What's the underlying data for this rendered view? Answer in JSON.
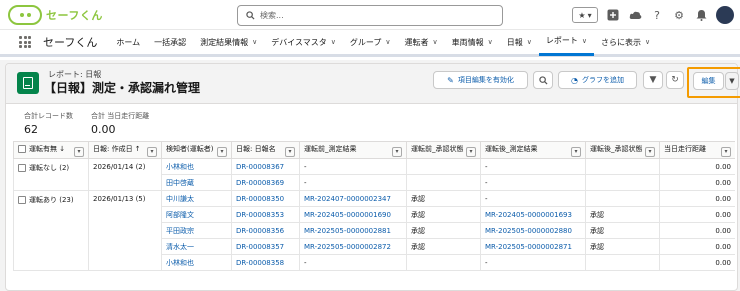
{
  "header": {
    "logo_text": "セーフくん",
    "search_placeholder": "検索..."
  },
  "nav": {
    "app_name": "セーフくん",
    "items": [
      {
        "label": "ホーム",
        "chevron": false
      },
      {
        "label": "一括承認",
        "chevron": false
      },
      {
        "label": "測定結果情報",
        "chevron": true
      },
      {
        "label": "デバイスマスタ",
        "chevron": true
      },
      {
        "label": "グループ",
        "chevron": true
      },
      {
        "label": "運転者",
        "chevron": true
      },
      {
        "label": "車両情報",
        "chevron": true
      },
      {
        "label": "日報",
        "chevron": true
      },
      {
        "label": "レポート",
        "chevron": true,
        "active": true
      },
      {
        "label": "さらに表示",
        "chevron": true
      }
    ]
  },
  "report": {
    "subtitle": "レポート: 日報",
    "title": "【日報】測定・承認漏れ管理",
    "buttons": {
      "inline_edit": "項目編集を有効化",
      "add_chart": "グラフを追加",
      "edit": "編集"
    },
    "summary": [
      {
        "label": "合計レコード数",
        "value": "62"
      },
      {
        "label": "合計 当日走行距離",
        "value": "0.00"
      }
    ]
  },
  "table": {
    "columns": [
      "運転有無 ↓",
      "日報: 作成日 ↑",
      "検知者(運転者)",
      "日報: 日報名",
      "運転前_測定結果",
      "運転前_承認状態",
      "運転後_測定結果",
      "運転後_承認状態",
      "当日走行距離"
    ],
    "groups": [
      {
        "group": "運転なし (2)",
        "date": "2026/01/14 (2)",
        "rows": [
          {
            "driver": "小林和也",
            "report": "DR-00008367",
            "pre_result": "-",
            "pre_status": "",
            "post_result": "-",
            "post_status": "",
            "distance": "0.00"
          },
          {
            "driver": "田中啓蔵",
            "report": "DR-00008369",
            "pre_result": "-",
            "pre_status": "",
            "post_result": "-",
            "post_status": "",
            "distance": "0.00"
          }
        ]
      },
      {
        "group": "運転あり (23)",
        "date": "2026/01/13 (5)",
        "rows": [
          {
            "driver": "中川謙太",
            "report": "DR-00008350",
            "pre_result": "MR-202407-0000002347",
            "pre_status": "承認",
            "post_result": "-",
            "post_status": "",
            "distance": "0.00"
          },
          {
            "driver": "阿部隆文",
            "report": "DR-00008353",
            "pre_result": "MR-202405-0000001690",
            "pre_status": "承認",
            "post_result": "MR-202405-0000001693",
            "post_status": "承認",
            "distance": "0.00"
          },
          {
            "driver": "平田政宗",
            "report": "DR-00008356",
            "pre_result": "MR-202505-0000002881",
            "pre_status": "承認",
            "post_result": "MR-202505-0000002880",
            "post_status": "承認",
            "distance": "0.00"
          },
          {
            "driver": "清水太一",
            "report": "DR-00008357",
            "pre_result": "MR-202505-0000002872",
            "pre_status": "承認",
            "post_result": "MR-202505-0000002871",
            "post_status": "承認",
            "distance": "0.00"
          },
          {
            "driver": "小林和也",
            "report": "DR-00008358",
            "pre_result": "-",
            "pre_status": "",
            "post_result": "-",
            "post_status": "",
            "distance": "0.00"
          }
        ]
      }
    ]
  },
  "colors": {
    "brand_green": "#8dc63f",
    "report_icon": "#04844b",
    "link": "#0b5cab",
    "highlight": "#f49b00"
  }
}
